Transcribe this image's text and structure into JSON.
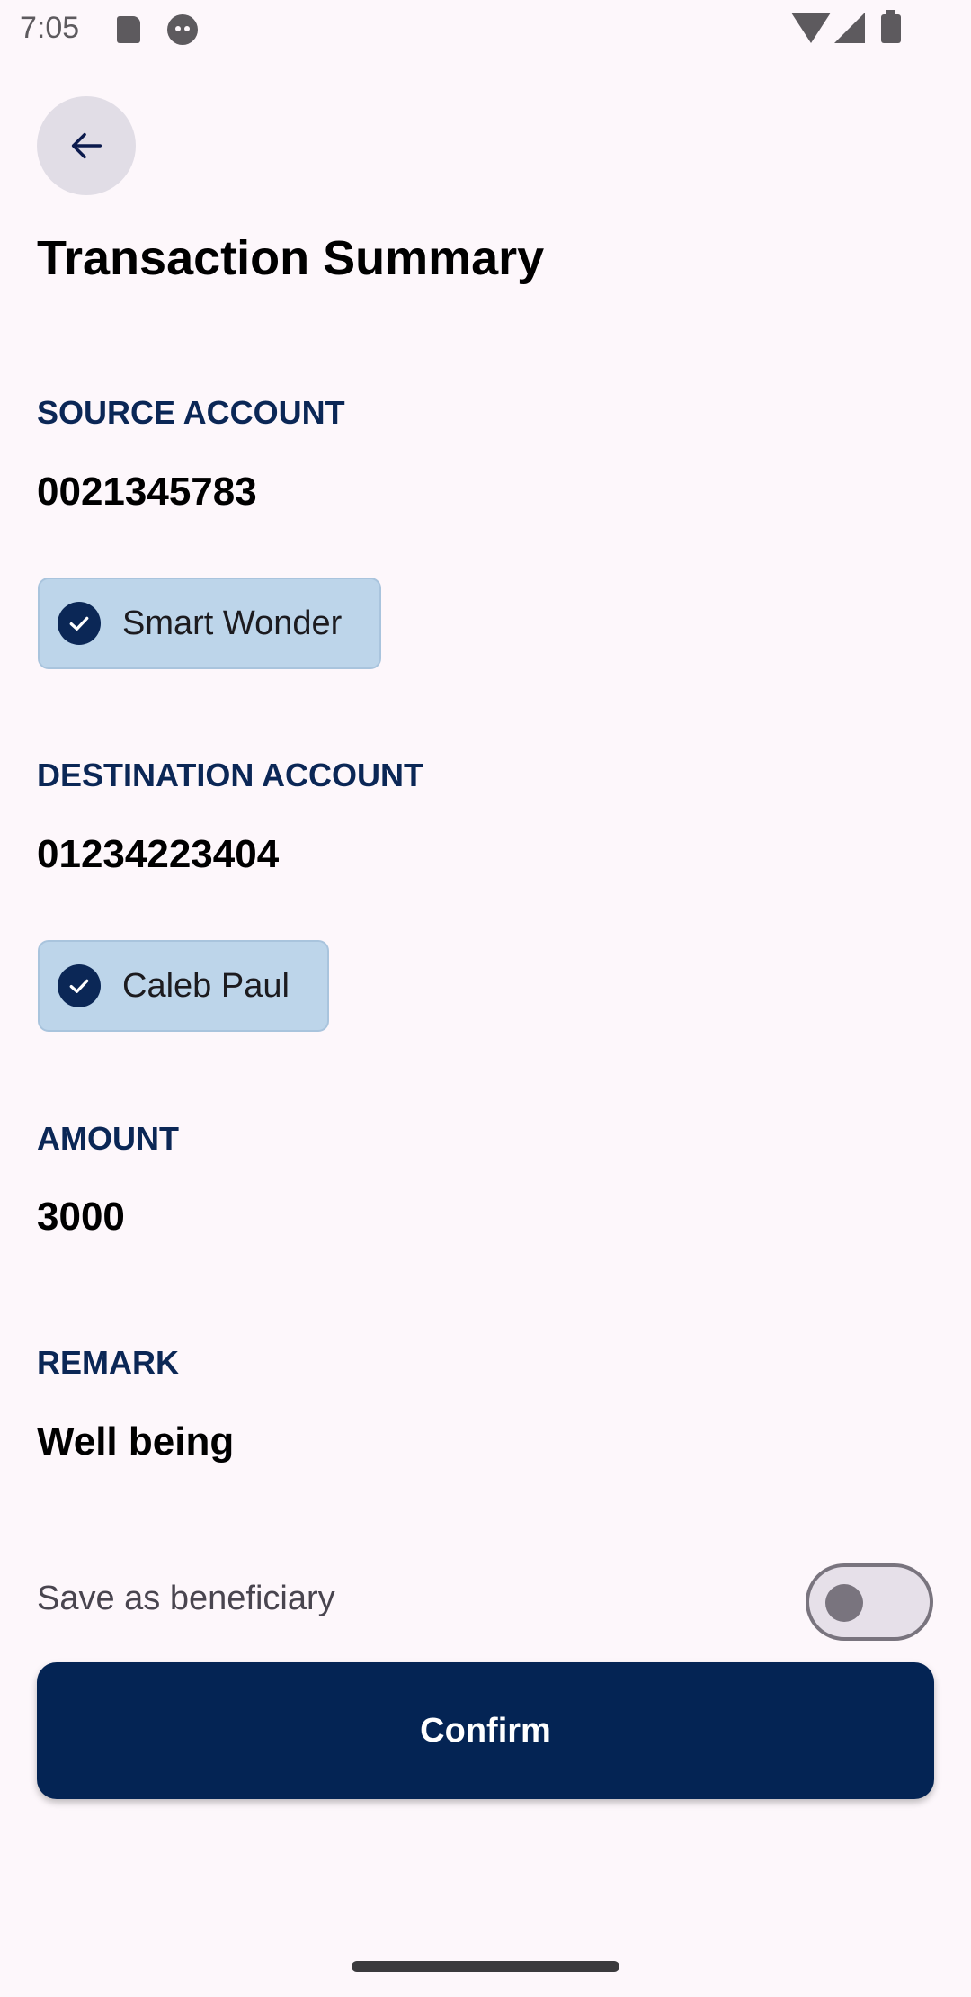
{
  "status_bar": {
    "time": "7:05",
    "icons": [
      "sd-card-icon",
      "face-icon",
      "wifi-icon",
      "signal-icon",
      "battery-icon"
    ]
  },
  "header": {
    "back_icon": "arrow-left-icon",
    "title": "Transaction Summary"
  },
  "source_account": {
    "label": "SOURCE ACCOUNT",
    "number": "0021345783",
    "name": "Smart Wonder"
  },
  "destination_account": {
    "label": "DESTINATION ACCOUNT",
    "number": "01234223404",
    "name": "Caleb Paul"
  },
  "amount": {
    "label": "AMOUNT",
    "value": "3000"
  },
  "remark": {
    "label": "REMARK",
    "value": "Well being"
  },
  "save_beneficiary": {
    "label": "Save as beneficiary",
    "checked": false
  },
  "confirm": {
    "label": "Confirm"
  },
  "colors": {
    "background": "#fdf7fb",
    "accent": "#042454",
    "section_label": "#0b2756",
    "chip_background": "#bdd5ea"
  }
}
